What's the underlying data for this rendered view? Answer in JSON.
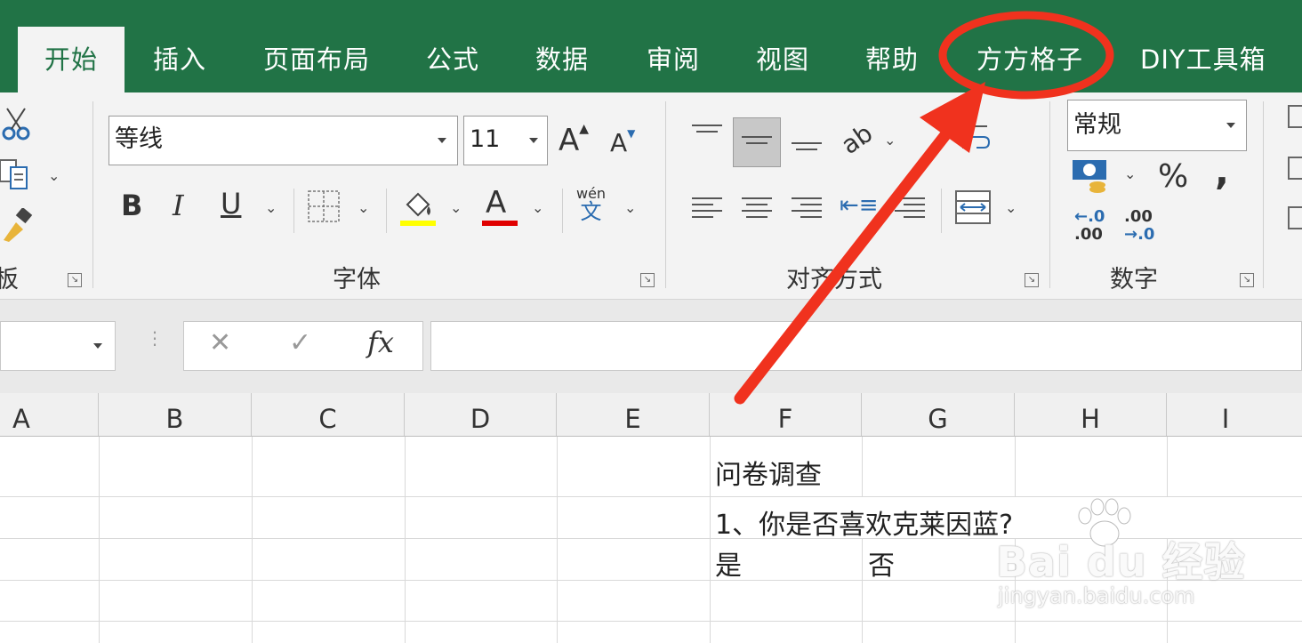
{
  "tabs": [
    {
      "label": "开始",
      "active": true
    },
    {
      "label": "插入"
    },
    {
      "label": "页面布局"
    },
    {
      "label": "公式"
    },
    {
      "label": "数据"
    },
    {
      "label": "审阅"
    },
    {
      "label": "视图"
    },
    {
      "label": "帮助"
    },
    {
      "label": "方方格子"
    },
    {
      "label": "DIY工具箱"
    }
  ],
  "ribbon": {
    "clipboard_label_fragment": "板",
    "font": {
      "name": "等线",
      "size": "11",
      "grow": "A",
      "shrink": "A",
      "bold": "B",
      "italic": "I",
      "underline": "U",
      "font_color_letter": "A",
      "phonetic_top": "wén",
      "phonetic_bottom": "文",
      "group_label": "字体",
      "highlight_color": "#ffff00",
      "font_color": "#e00000"
    },
    "alignment": {
      "group_label": "对齐方式"
    },
    "number": {
      "format": "常规",
      "percent": "%",
      "comma": ",",
      "inc_decimal_top": "←.0",
      "inc_decimal_bottom": ".00",
      "dec_decimal_top": ".00",
      "dec_decimal_bottom": "→.0",
      "group_label": "数字"
    }
  },
  "formula_bar": {
    "cancel": "✕",
    "enter": "✓",
    "fx": "fx",
    "value": ""
  },
  "columns": [
    "A",
    "B",
    "C",
    "D",
    "E",
    "F",
    "G",
    "H",
    "I"
  ],
  "cells": {
    "f1": "问卷调查",
    "f2": "1、你是否喜欢克莱因蓝?",
    "f3": "是",
    "g3": "否"
  },
  "watermark": {
    "logo": "Bai du 经验",
    "url": "jingyan.baidu.com"
  },
  "colors": {
    "excel_green": "#217346",
    "annotation_red": "#f0321e"
  }
}
